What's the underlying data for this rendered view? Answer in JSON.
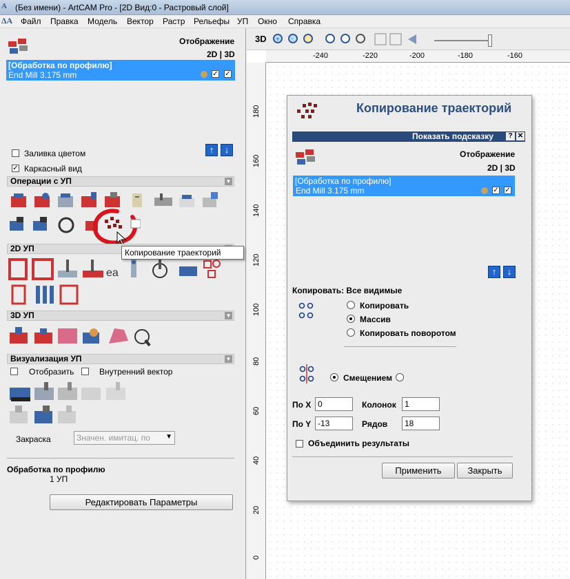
{
  "window": {
    "title": "(Без имени) - ArtCAM Pro - [2D Вид:0 - Растровый слой]"
  },
  "menu": [
    "Файл",
    "Правка",
    "Модель",
    "Вектор",
    "Растр",
    "Рельефы",
    "УП",
    "Окно",
    "Справка"
  ],
  "left": {
    "display_label": "Отображение",
    "mode_label": "2D | 3D",
    "toolpath_item": {
      "line1": "[Обработка по профилю]",
      "line2": "End Mill 3.175 mm"
    },
    "fill_color_label": "Заливка цветом",
    "wireframe_label": "Каркасный вид",
    "sections": {
      "ops": "Операции с УП",
      "ops2d": "2D УП",
      "ops3d": "3D УП",
      "viz": "Визуализация УП"
    },
    "show_label": "Отобразить",
    "inner_vector_label": "Внутренний вектор",
    "shading_label": "Закраска",
    "shading_value": "Значен. имитац. по",
    "summary_title": "Обработка по профилю",
    "summary_count": "1 УП",
    "edit_button": "Редактировать Параметры"
  },
  "tooltip": "Копирование траекторий",
  "toolbar": {
    "view3d": "3D"
  },
  "ruler": {
    "x": [
      "-240",
      "-220",
      "-200",
      "-180",
      "-160"
    ],
    "y": [
      "180",
      "160",
      "140",
      "120",
      "100",
      "80",
      "60",
      "40",
      "20",
      "0"
    ]
  },
  "dialog": {
    "title": "Копирование траекторий",
    "hint": "Показать подсказку",
    "display_label": "Отображение",
    "mode_label": "2D | 3D",
    "toolpath_item": {
      "line1": "[Обработка по профилю]",
      "line2": "End Mill 3.175 mm"
    },
    "copy_label": "Копировать: Все видимые",
    "radio_copy": "Копировать",
    "radio_array": "Массив",
    "radio_rotate": "Копировать поворотом",
    "offset_label": "Смещением",
    "x_label": "По X",
    "x_value": "0",
    "y_label": "По Y",
    "y_value": "-13",
    "cols_label": "Колонок",
    "cols_value": "1",
    "rows_label": "Рядов",
    "rows_value": "18",
    "merge_label": "Объединить результаты",
    "apply": "Применить",
    "close": "Закрыть"
  },
  "colors": {
    "selection": "#3399ff",
    "hint_bar": "#2b4a7c",
    "title_blue": "#2c4f86",
    "arrow_blue": "#2266cc"
  }
}
